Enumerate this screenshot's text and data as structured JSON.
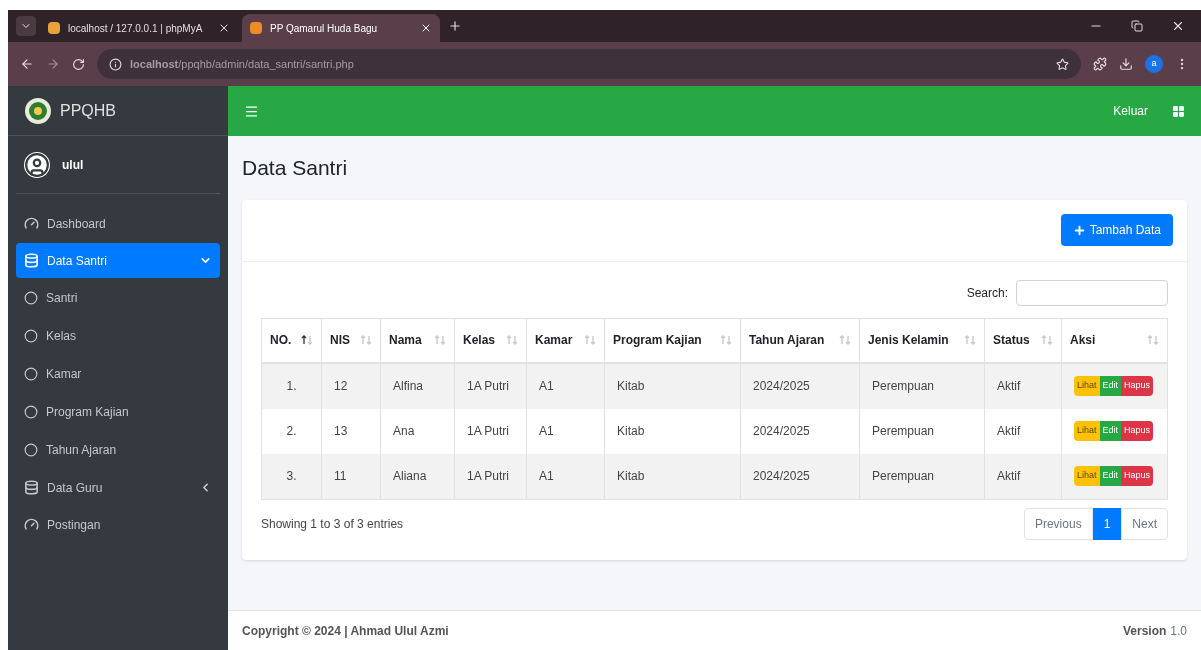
{
  "browser": {
    "tabs": [
      {
        "title": "localhost / 127.0.0.1 | phpMyA",
        "selected": false
      },
      {
        "title": "PP Qamarul Huda Bagu",
        "selected": true
      }
    ],
    "url": "**localhost**/ppqhb/admin/data_santri/santri.php",
    "profile": "a"
  },
  "sidebar": {
    "brand": "PPQHB",
    "user": "ulul",
    "items": [
      {
        "label": "Dashboard",
        "kind": "gauge",
        "selected": false
      },
      {
        "label": "Data Santri",
        "kind": "database",
        "selected": true,
        "expanded": true,
        "children": [
          {
            "label": "Santri",
            "selected": false
          },
          {
            "label": "Kelas",
            "selected": false
          },
          {
            "label": "Kamar",
            "selected": false
          },
          {
            "label": "Program Kajian",
            "selected": false
          },
          {
            "label": "Tahun Ajaran",
            "selected": false
          }
        ]
      },
      {
        "label": "Data Guru",
        "kind": "database",
        "selected": false,
        "expanded": false
      },
      {
        "label": "Postingan",
        "kind": "gauge",
        "selected": false
      }
    ]
  },
  "header": {
    "logout": "Keluar"
  },
  "page_title": "Data Santri",
  "add_button": "Tambah Data",
  "search": {
    "label": "Search:"
  },
  "table": {
    "columns": [
      {
        "label": "NO.",
        "sorted": true
      },
      {
        "label": "NIS",
        "sorted": false
      },
      {
        "label": "Nama",
        "sorted": false
      },
      {
        "label": "Kelas",
        "sorted": false
      },
      {
        "label": "Kamar",
        "sorted": false
      },
      {
        "label": "Program Kajian",
        "sorted": false
      },
      {
        "label": "Tahun Ajaran",
        "sorted": false
      },
      {
        "label": "Jenis Kelamin",
        "sorted": false
      },
      {
        "label": "Status",
        "sorted": false
      },
      {
        "label": "Aksi",
        "sorted": false
      }
    ],
    "rows": [
      {
        "cells": [
          "1.",
          "12",
          "Alfina",
          "1A Putri",
          "A1",
          "Kitab",
          "2024/2025",
          "Perempuan",
          "Aktif"
        ],
        "actions": [
          {
            "label": "Lihat",
            "kind": "view"
          },
          {
            "label": "Edit",
            "kind": "edit"
          },
          {
            "label": "Hapus",
            "kind": "delete"
          }
        ]
      },
      {
        "cells": [
          "2.",
          "13",
          "Ana",
          "1A Putri",
          "A1",
          "Kitab",
          "2024/2025",
          "Perempuan",
          "Aktif"
        ],
        "actions": [
          {
            "label": "Lihat",
            "kind": "view"
          },
          {
            "label": "Edit",
            "kind": "edit"
          },
          {
            "label": "Hapus",
            "kind": "delete"
          }
        ]
      },
      {
        "cells": [
          "3.",
          "11",
          "Aliana",
          "1A Putri",
          "A1",
          "Kitab",
          "2024/2025",
          "Perempuan",
          "Aktif"
        ],
        "actions": [
          {
            "label": "Lihat",
            "kind": "view"
          },
          {
            "label": "Edit",
            "kind": "edit"
          },
          {
            "label": "Hapus",
            "kind": "delete"
          }
        ]
      }
    ]
  },
  "info": "Showing 1 to 3 of 3 entries",
  "pagination": [
    {
      "label": "Previous",
      "selected": false
    },
    {
      "label": "1",
      "selected": true
    },
    {
      "label": "Next",
      "selected": false
    }
  ],
  "footer": {
    "copyright": "Copyright © 2024 | Ahmad Ulul Azmi",
    "version_label": "Version",
    "version": "1.0"
  }
}
